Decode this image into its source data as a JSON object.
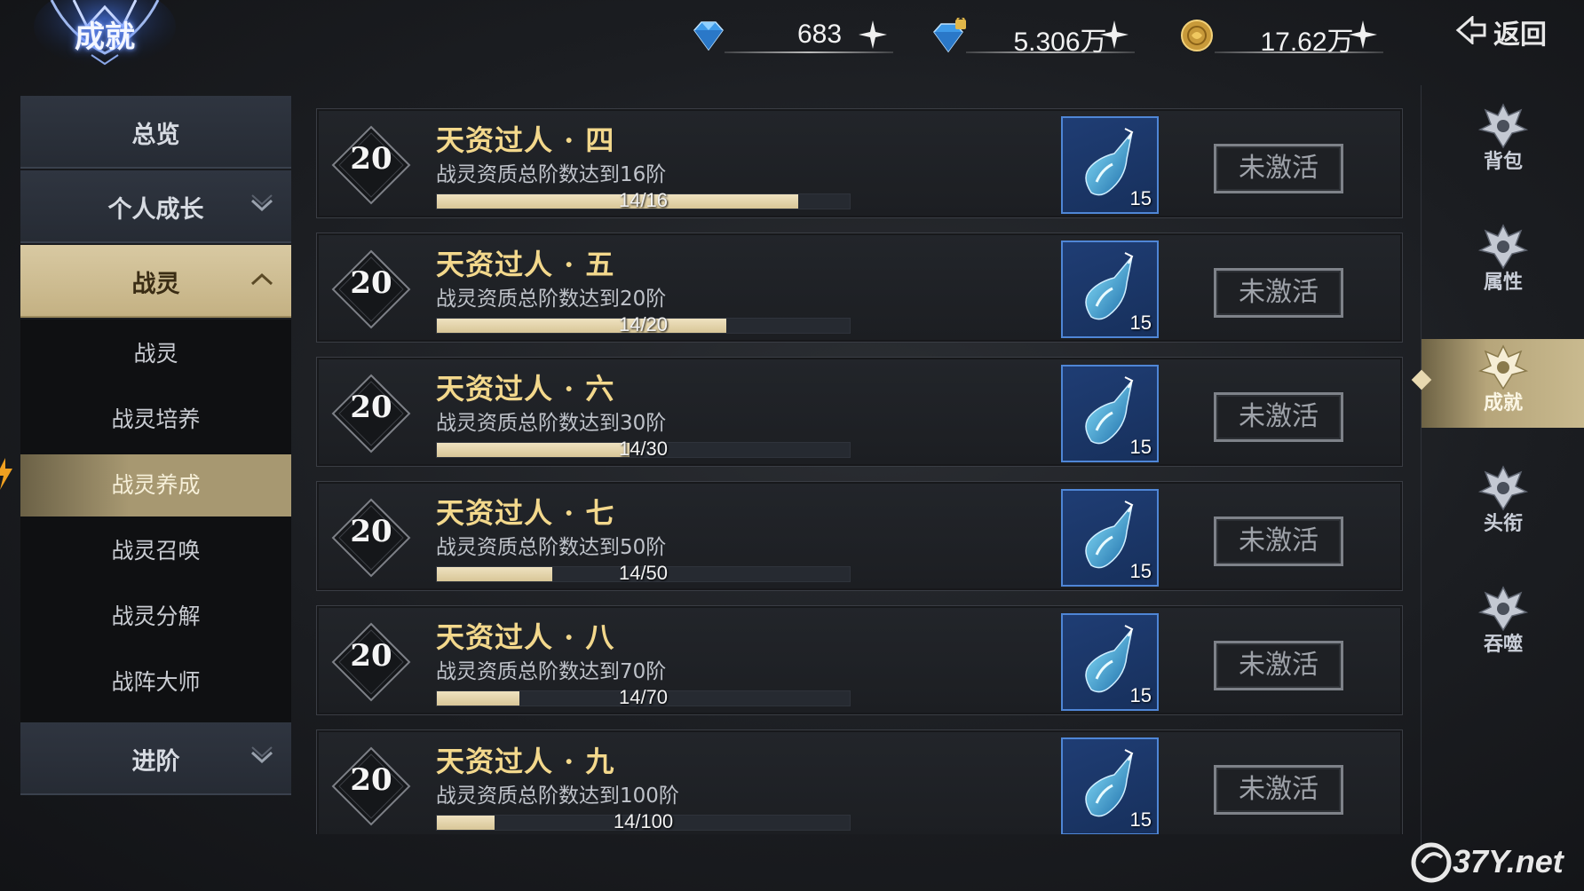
{
  "header": {
    "title": "成就",
    "back_label": "返回"
  },
  "currencies": [
    {
      "icon": "diamond-icon",
      "value": "683"
    },
    {
      "icon": "bound-diamond-icon",
      "value": "5.306万"
    },
    {
      "icon": "gold-coin-icon",
      "value": "17.62万"
    }
  ],
  "leftnav": {
    "overview": "总览",
    "growth": "个人成长",
    "spirit": "战灵",
    "sub_items": [
      "战灵",
      "战灵培养",
      "战灵养成",
      "战灵召唤",
      "战灵分解",
      "战阵大师"
    ],
    "active_sub": 2,
    "advance": "进阶"
  },
  "achievements": [
    {
      "points": "20",
      "title": "天资过人 · 四",
      "desc": "战灵资质总阶数达到16阶",
      "progress_text": "14/16",
      "progress": 0.875,
      "reward_count": "15",
      "status": "未激活"
    },
    {
      "points": "20",
      "title": "天资过人 · 五",
      "desc": "战灵资质总阶数达到20阶",
      "progress_text": "14/20",
      "progress": 0.7,
      "reward_count": "15",
      "status": "未激活"
    },
    {
      "points": "20",
      "title": "天资过人 · 六",
      "desc": "战灵资质总阶数达到30阶",
      "progress_text": "14/30",
      "progress": 0.4667,
      "reward_count": "15",
      "status": "未激活"
    },
    {
      "points": "20",
      "title": "天资过人 · 七",
      "desc": "战灵资质总阶数达到50阶",
      "progress_text": "14/50",
      "progress": 0.28,
      "reward_count": "15",
      "status": "未激活"
    },
    {
      "points": "20",
      "title": "天资过人 · 八",
      "desc": "战灵资质总阶数达到70阶",
      "progress_text": "14/70",
      "progress": 0.2,
      "reward_count": "15",
      "status": "未激活"
    },
    {
      "points": "20",
      "title": "天资过人 · 九",
      "desc": "战灵资质总阶数达到100阶",
      "progress_text": "14/100",
      "progress": 0.14,
      "reward_count": "15",
      "status": "未激活"
    }
  ],
  "rail": [
    {
      "label": "背包",
      "icon": "bag-icon"
    },
    {
      "label": "属性",
      "icon": "attribute-icon"
    },
    {
      "label": "成就",
      "icon": "achievement-icon",
      "active": true
    },
    {
      "label": "头衔",
      "icon": "title-icon"
    },
    {
      "label": "吞噬",
      "icon": "devour-icon"
    }
  ],
  "watermark": "37Y.net",
  "colors": {
    "accent_gold": "#f3d88c",
    "active_tab": "#c9ba8f",
    "reward_bg": "#1f3d74",
    "progress_fill": "#e6d6ab"
  }
}
